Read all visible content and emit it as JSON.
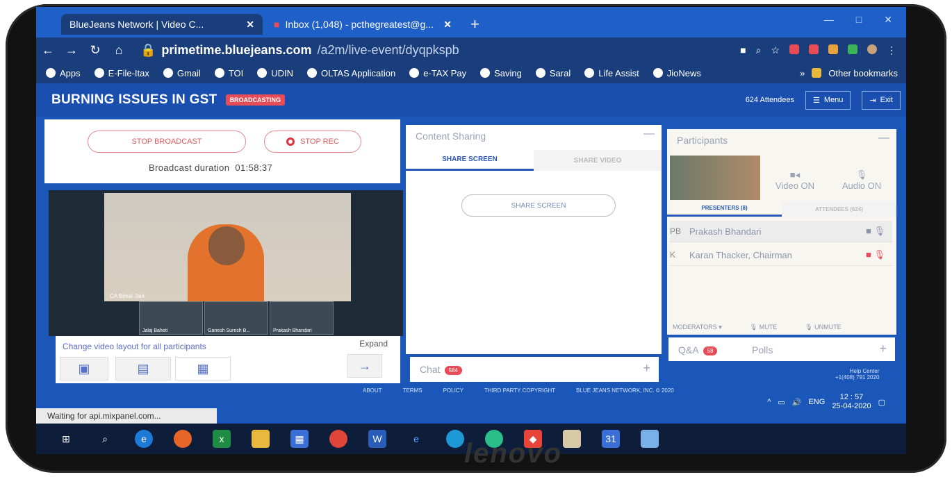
{
  "browser": {
    "tab_active": "BlueJeans Network | Video C...",
    "tab_inactive": "Inbox (1,048) - pcthegreatest@g...",
    "url_host": "primetime.bluejeans.com",
    "url_path": "/a2m/live-event/dyqpkspb",
    "bookmarks": [
      "Apps",
      "E-File-Itax",
      "Gmail",
      "TOI",
      "UDIN",
      "OLTAS Application",
      "e-TAX Pay",
      "Saving",
      "Saral",
      "Life Assist",
      "JioNews"
    ],
    "other_bookmarks": "Other bookmarks"
  },
  "app": {
    "title": "BURNING ISSUES IN GST",
    "broadcast_badge": "BROADCASTING",
    "attendees": "624 Attendees",
    "menu": "Menu",
    "exit": "Exit"
  },
  "broadcast": {
    "stop_broadcast": "STOP BROADCAST",
    "stop_rec": "STOP REC",
    "duration_label": "Broadcast duration",
    "duration_value": "01:58:37"
  },
  "video": {
    "main_label": "CA Bimal Jain",
    "thumbs": [
      "Jalaj Baheti",
      "Ganesh Suresh B...",
      "Prakash Bhandari"
    ]
  },
  "layout": {
    "change_label": "Change video layout for all participants",
    "expand": "Expand"
  },
  "content": {
    "title": "Content Sharing",
    "tab_share_screen": "SHARE SCREEN",
    "tab_share_video": "SHARE VIDEO",
    "share_button": "SHARE SCREEN"
  },
  "chat": {
    "label": "Chat",
    "count": "584"
  },
  "participants": {
    "title": "Participants",
    "video_on": "Video ON",
    "audio_on": "Audio ON",
    "tab_presenters": "PRESENTERS (8)",
    "tab_attendees": "ATTENDEES (624)",
    "rows": [
      {
        "initials": "PB",
        "name": "Prakash Bhandari"
      },
      {
        "initials": "K",
        "name": "Karan Thacker, Chairman"
      }
    ],
    "moderators": "MODERATORS",
    "mute": "MUTE",
    "unmute": "UNMUTE"
  },
  "qa": {
    "label": "Q&A",
    "count": "58",
    "polls": "Polls"
  },
  "footer": {
    "links": [
      "ABOUT",
      "TERMS",
      "POLICY",
      "THIRD PARTY COPYRIGHT",
      "BLUE JEANS NETWORK, INC. © 2020"
    ],
    "help": "Help Center",
    "phone": "+1(408) 791 2020"
  },
  "status_text": "Waiting for api.mixpanel.com...",
  "tray": {
    "lang": "ENG",
    "time": "12 : 57",
    "date": "25-04-2020"
  },
  "monitor_brand": "lenovo",
  "colors": {
    "app_blue": "#1a4fb0",
    "badge_red": "#e84d57"
  }
}
